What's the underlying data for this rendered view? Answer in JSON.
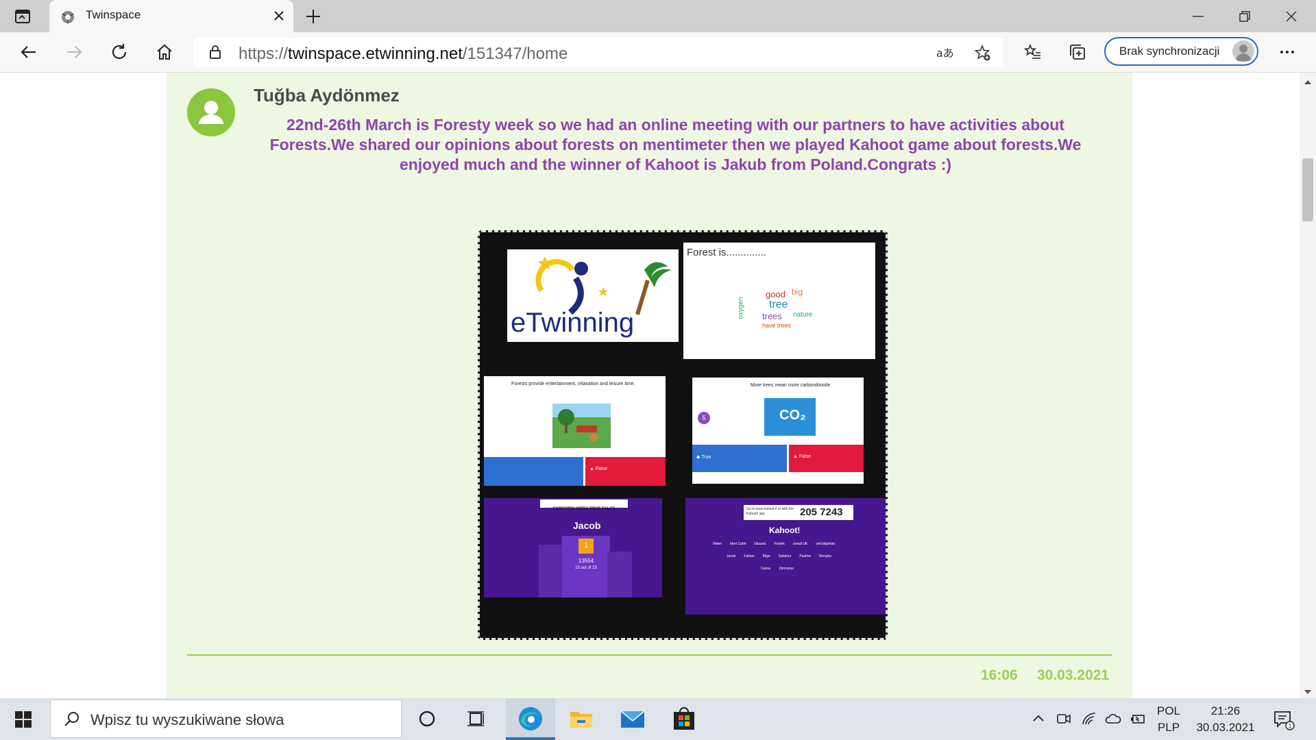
{
  "browser": {
    "tab_title": "Twinspace",
    "url_prefix": "https://",
    "url_host": "twinspace.etwinning.net",
    "url_path": "/151347/home",
    "sync_label": "Brak synchronizacji"
  },
  "post": {
    "author": "Tuğba Aydönmez",
    "message": "22nd-26th March is Foresty week so we had an online meeting with our partners to have activities about Forests.We shared our opinions about forests on mentimeter then we played Kahoot game about forests.We enjoyed much and the winner of Kahoot is Jakub from Poland.Congrats :)",
    "time": "16:06",
    "date": "30.03.2021",
    "collage": {
      "logo_text": "eTwinning",
      "forest_title": "Forest is..............",
      "words": [
        "good",
        "big",
        "tree",
        "trees",
        "nature",
        "oxygen",
        "have trees"
      ],
      "slide1_question": "Forests provide entertainment, relaxation and leisure time.",
      "slide1_false": "▲ False",
      "slide2_question": "More trees mean more carbondioxide",
      "slide2_badge": "5",
      "slide2_co2": "CO₂",
      "slide2_true": "◆ True",
      "slide2_false": "▲ False",
      "podium_header": "FORESTRY WEEK TRUE FALSE",
      "podium_winner": "Jacob",
      "podium_rank": "1",
      "podium_score": "13554",
      "podium_sub": "15 out of 15",
      "pin_label": "Go to www.kahoot.it or with the Kahoot! app",
      "pin": "205 7243",
      "kahoot_logo": "Kahoot!",
      "players_row1": [
        "Helen",
        "Mert Cahit",
        "Oksana",
        "Franek",
        "Ismail UK",
        "veli bilgehan"
      ],
      "players_row2": [
        "Jacob",
        "Fabian",
        "Bilge",
        "Sahimur",
        "Paulina",
        "Bengisu"
      ],
      "players_row3": [
        "Cansu",
        "Zümranur"
      ]
    }
  },
  "taskbar": {
    "search_placeholder": "Wpisz tu wyszukiwane słowa",
    "lang_top": "POL",
    "lang_bottom": "PLP",
    "time": "21:26",
    "date": "30.03.2021",
    "notification_count": "1"
  },
  "colors": {
    "post_bg": "#eef7e1",
    "accent_green": "#9ccc5a",
    "message_purple": "#8e44ad",
    "kahoot_purple": "#46178f"
  }
}
